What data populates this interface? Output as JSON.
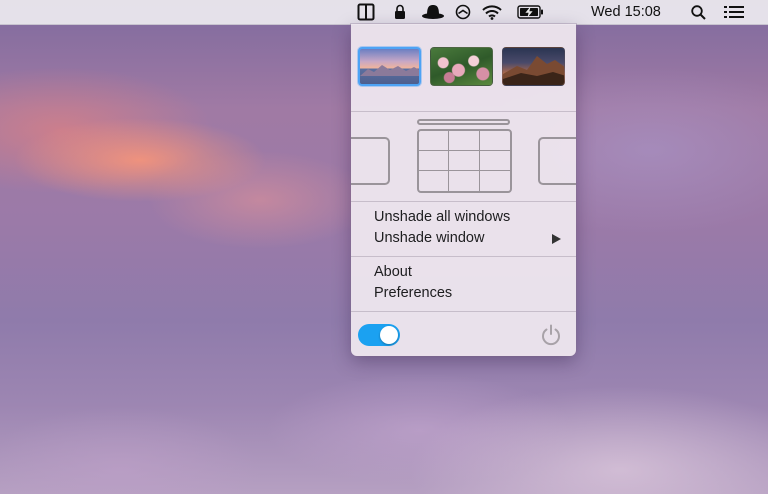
{
  "menubar": {
    "clock": "Wed 15:08",
    "icons": [
      "window-shade-app-icon",
      "lock-icon",
      "hat-icon",
      "circle-arrow-icon",
      "wifi-icon",
      "battery-charging-icon",
      "search-icon",
      "list-icon"
    ],
    "active_color": "#3d7fe0"
  },
  "popover": {
    "thumbnails": [
      {
        "name": "mountain-sunset",
        "selected": true
      },
      {
        "name": "pink-berries",
        "selected": false
      },
      {
        "name": "mountain-night",
        "selected": false
      }
    ],
    "menu_group_1": [
      "Unshade all windows",
      "Unshade window"
    ],
    "menu_group_2": [
      "About",
      "Preferences"
    ],
    "toggle_on": true,
    "accent_color": "#1ba1f1",
    "selected_color": "#4da3f5"
  }
}
